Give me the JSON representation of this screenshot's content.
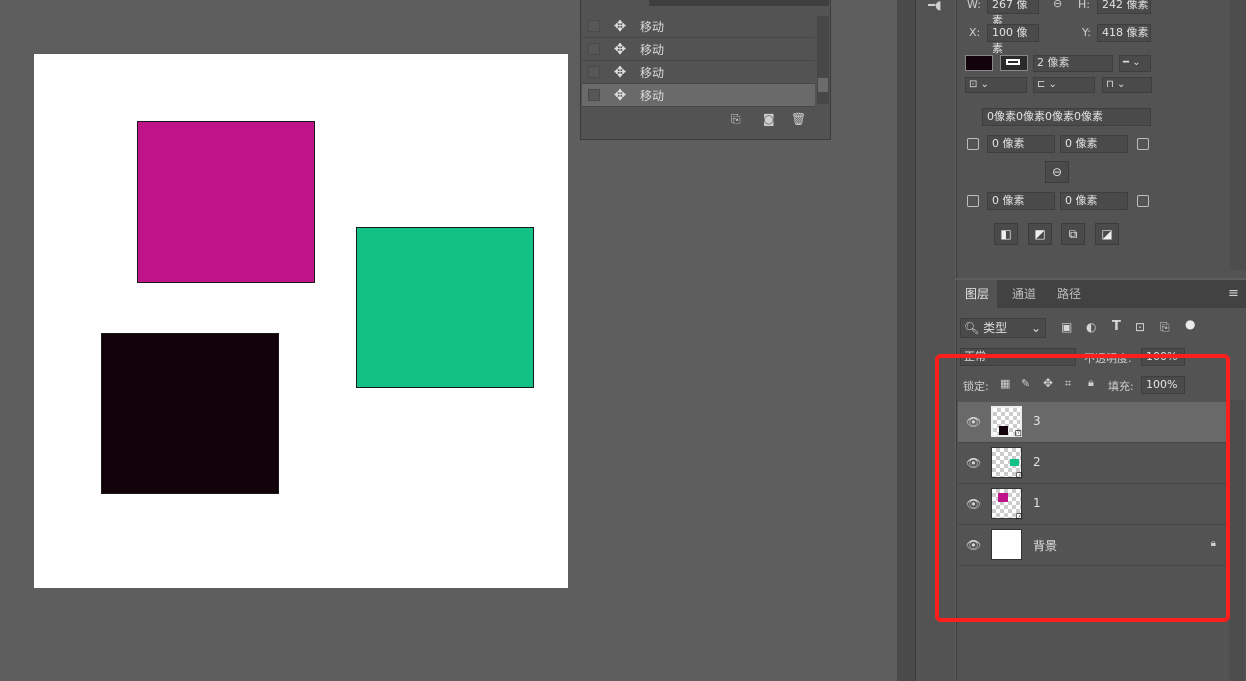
{
  "history": {
    "items": [
      {
        "label": "移动",
        "selected": false
      },
      {
        "label": "移动",
        "selected": false
      },
      {
        "label": "移动",
        "selected": false
      },
      {
        "label": "移动",
        "selected": true
      }
    ],
    "move_icon": "move-arrows-icon"
  },
  "canvas": {
    "shapes": [
      {
        "name": "magenta-square",
        "color": "#c0138a"
      },
      {
        "name": "green-square",
        "color": "#12c184"
      },
      {
        "name": "black-square",
        "color": "#12020a"
      }
    ]
  },
  "properties": {
    "w_label": "W:",
    "w_value": "267 像素",
    "link_label": "⊖",
    "h_label": "H:",
    "h_value": "242 像素",
    "x_label": "X:",
    "x_value": "100 像素",
    "y_label": "Y:",
    "y_value": "418 像素",
    "fill_color": "#12020a",
    "stroke_width": "2 像素",
    "corner_all": "0像素0像素0像素0像素",
    "corner_tl": "0 像素",
    "corner_tr": "0 像素",
    "corner_bl": "0 像素",
    "corner_br": "0 像素"
  },
  "layers_panel": {
    "tabs": [
      "图层",
      "通道",
      "路径"
    ],
    "filter_label": "类型",
    "blend_mode": "正常",
    "opacity_label": "不透明度:",
    "opacity_value": "100%",
    "lock_label": "锁定:",
    "fill_label": "填充:",
    "fill_value": "100%",
    "layers": [
      {
        "name": "3",
        "selected": true,
        "thumb_color": "#12020a"
      },
      {
        "name": "2",
        "selected": false,
        "thumb_color": "#12c184"
      },
      {
        "name": "1",
        "selected": false,
        "thumb_color": "#c0138a"
      },
      {
        "name": "背景",
        "selected": false,
        "locked": true
      }
    ]
  },
  "highlight_color": "#ff1e1e"
}
